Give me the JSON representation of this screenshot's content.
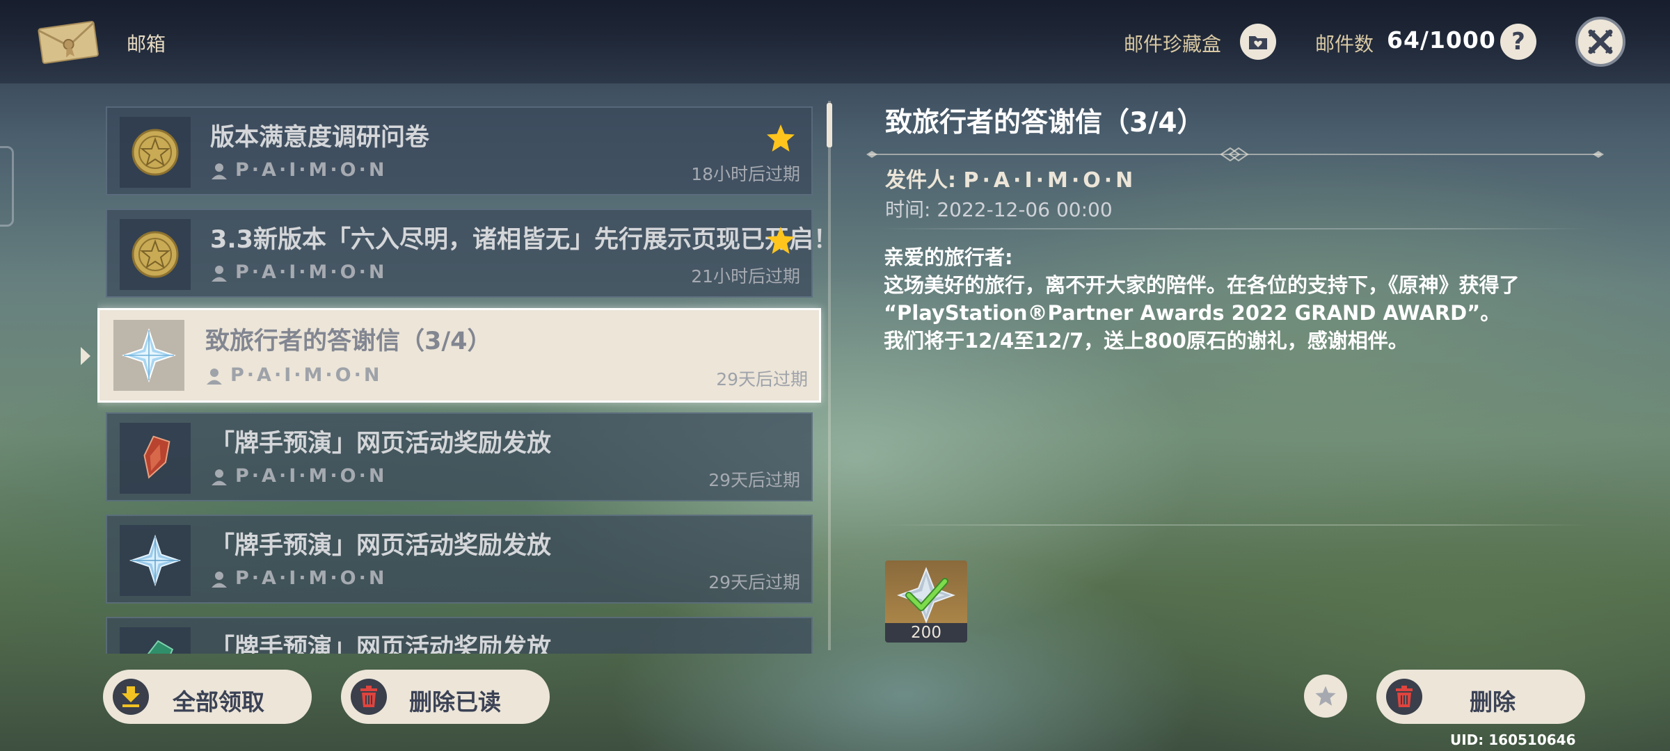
{
  "header": {
    "title": "邮箱",
    "collection_label": "邮件珍藏盒",
    "count_label": "邮件数",
    "count_value": "64/1000",
    "help_label": "?"
  },
  "mail_list": [
    {
      "title": "版本满意度调研问卷",
      "sender": "P·A·I·M·O·N",
      "expire": "18小时后过期",
      "starred": true,
      "icon": "paimon-medal-icon"
    },
    {
      "title": "3.3新版本「六入尽明，诸相皆无」先行展示页现已开启！",
      "sender": "P·A·I·M·O·N",
      "expire": "21小时后过期",
      "starred": true,
      "icon": "paimon-medal-icon"
    },
    {
      "title": "致旅行者的答谢信（3/4）",
      "sender": "P·A·I·M·O·N",
      "expire": "29天后过期",
      "starred": false,
      "selected": true,
      "icon": "primogem-icon"
    },
    {
      "title": "「牌手预演」网页活动奖励发放",
      "sender": "P·A·I·M·O·N",
      "expire": "29天后过期",
      "starred": false,
      "icon": "red-card-icon"
    },
    {
      "title": "「牌手预演」网页活动奖励发放",
      "sender": "P·A·I·M·O·N",
      "expire": "29天后过期",
      "starred": false,
      "icon": "primogem-icon"
    },
    {
      "title": "「牌手预演」网页活动奖励发放",
      "sender": "",
      "expire": "",
      "starred": false,
      "icon": "green-card-icon"
    }
  ],
  "detail": {
    "title": "致旅行者的答谢信（3/4）",
    "sender_label": "发件人:",
    "sender_name": "P·A·I·M·O·N",
    "time": "时间: 2022-12-06 00:00",
    "body": [
      "亲爱的旅行者:",
      "这场美好的旅行，离不开大家的陪伴。在各位的支持下，《原神》获得了",
      "“PlayStation®Partner Awards 2022 GRAND AWARD”。",
      "我们将于12/4至12/7，送上800原石的谢礼，感谢相伴。"
    ],
    "reward": {
      "icon": "primogem-claimed-icon",
      "count": "200",
      "claimed": true
    }
  },
  "actions": {
    "claim_all": "全部领取",
    "delete_read": "删除已读",
    "delete": "删除"
  },
  "uid": "UID: 160510646",
  "colors": {
    "accent_cream": "#ece5d8",
    "star_gold": "#ffc51c",
    "delete_red": "#e0443e",
    "claim_yellow": "#f2c222",
    "text_gold": "#d9c9a4"
  }
}
